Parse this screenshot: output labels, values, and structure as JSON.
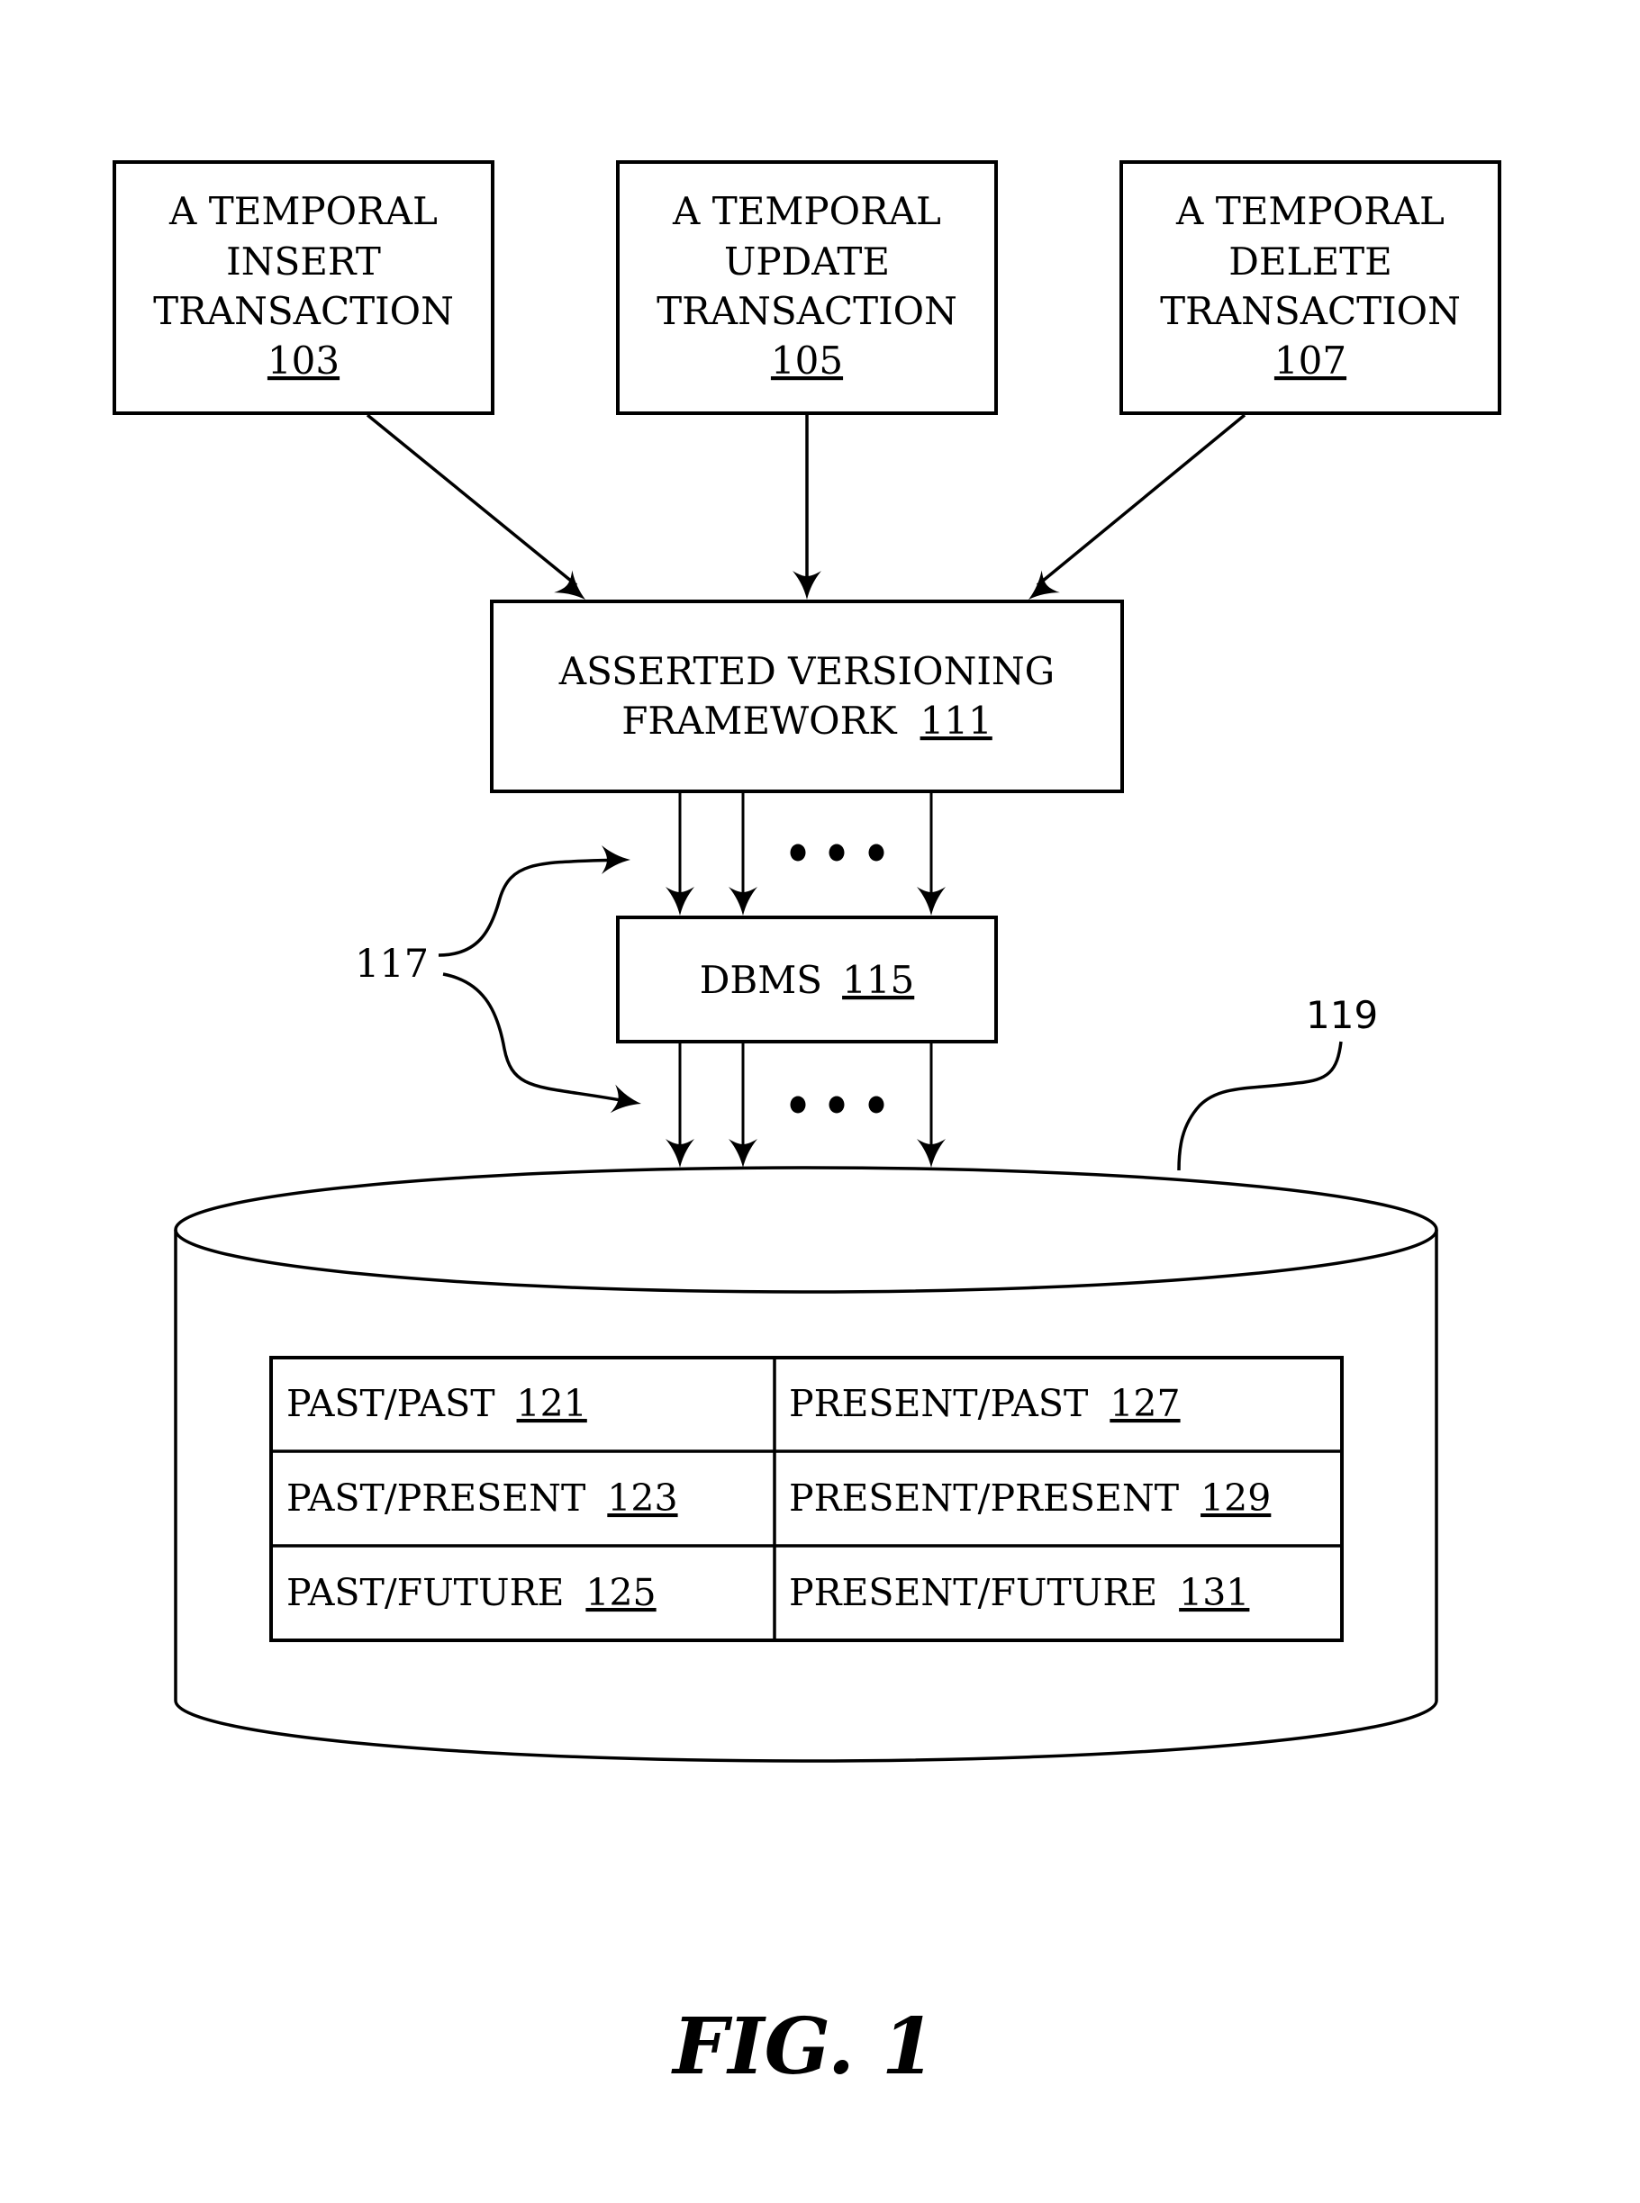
{
  "figure": {
    "caption": "FIG. 1"
  },
  "transactions": [
    {
      "lines": [
        "A TEMPORAL",
        "INSERT",
        "TRANSACTION"
      ],
      "ref": "103"
    },
    {
      "lines": [
        "A TEMPORAL",
        "UPDATE",
        "TRANSACTION"
      ],
      "ref": "105"
    },
    {
      "lines": [
        "A TEMPORAL",
        "DELETE",
        "TRANSACTION"
      ],
      "ref": "107"
    }
  ],
  "framework": {
    "line1": "ASSERTED VERSIONING",
    "line2": "FRAMEWORK",
    "ref": "111"
  },
  "dbms": {
    "label": "DBMS",
    "ref": "115"
  },
  "callouts": {
    "connections": "117",
    "database": "119"
  },
  "ellipsis": "...",
  "database_table": {
    "rows": [
      [
        {
          "label": "PAST/PAST",
          "ref": "121"
        },
        {
          "label": "PRESENT/PAST",
          "ref": "127"
        }
      ],
      [
        {
          "label": "PAST/PRESENT",
          "ref": "123"
        },
        {
          "label": "PRESENT/PRESENT",
          "ref": "129"
        }
      ],
      [
        {
          "label": "PAST/FUTURE",
          "ref": "125"
        },
        {
          "label": "PRESENT/FUTURE",
          "ref": "131"
        }
      ]
    ]
  }
}
